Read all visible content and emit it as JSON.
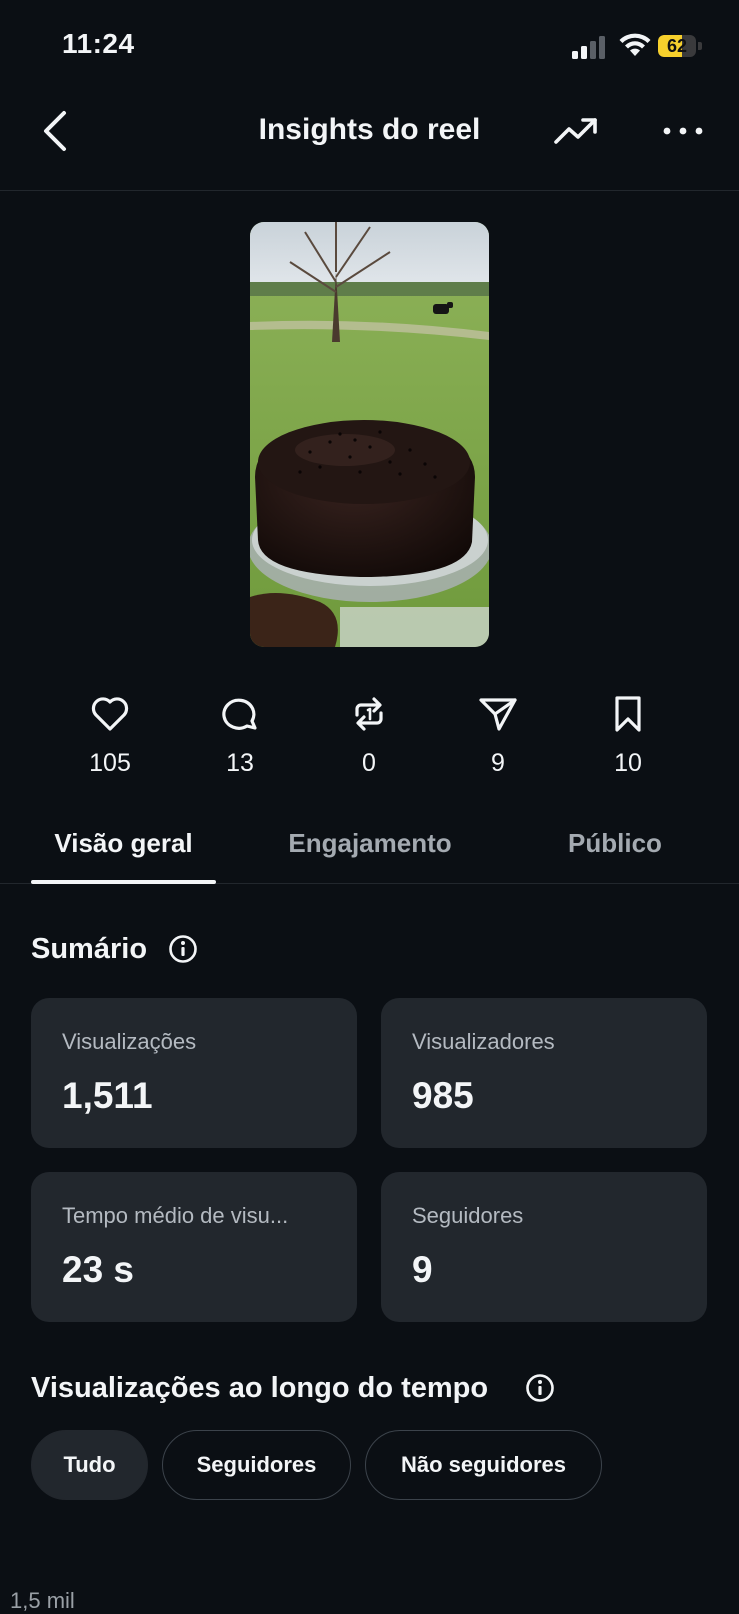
{
  "status_bar": {
    "time": "11:24",
    "battery": "62",
    "battery_level": 0.62
  },
  "header": {
    "title": "Insights do reel"
  },
  "stats": [
    {
      "name": "likes",
      "icon": "heart-icon",
      "value": "105"
    },
    {
      "name": "comments",
      "icon": "comment-icon",
      "value": "13"
    },
    {
      "name": "reposts",
      "icon": "repost-icon",
      "value": "0"
    },
    {
      "name": "shares",
      "icon": "send-icon",
      "value": "9"
    },
    {
      "name": "saves",
      "icon": "bookmark-icon",
      "value": "10"
    }
  ],
  "tabs": [
    {
      "label": "Visão geral",
      "active": true
    },
    {
      "label": "Engajamento",
      "active": false
    },
    {
      "label": "Público",
      "active": false
    }
  ],
  "summary": {
    "title": "Sumário",
    "cards": [
      {
        "label": "Visualizações",
        "value": "1,511"
      },
      {
        "label": "Visualizadores",
        "value": "985"
      },
      {
        "label": "Tempo médio de visu...",
        "value": "23 s"
      },
      {
        "label": "Seguidores",
        "value": "9"
      }
    ]
  },
  "views_over_time": {
    "title": "Visualizações ao longo do tempo",
    "filters": [
      {
        "label": "Tudo",
        "selected": true
      },
      {
        "label": "Seguidores",
        "selected": false
      },
      {
        "label": "Não seguidores",
        "selected": false
      }
    ],
    "axis_peek": "1,5 mil"
  },
  "colors": {
    "background": "#0b0f14",
    "card": "#22272d",
    "text": "#f3f5f7",
    "muted": "#a4aab1",
    "battery": "#f7d02c"
  }
}
